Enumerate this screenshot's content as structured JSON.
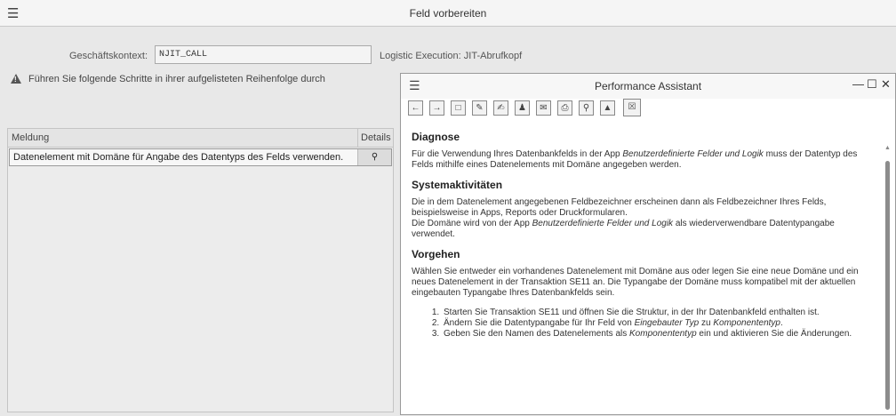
{
  "window": {
    "title": "Feld vorbereiten"
  },
  "context": {
    "label": "Geschäftskontext:",
    "value": "NJIT_CALL",
    "description": "Logistic Execution: JIT-Abrufkopf"
  },
  "warning": {
    "text": "Führen Sie folgende Schritte in ihrer aufgelisteten Reihenfolge durch"
  },
  "messages": {
    "headers": {
      "message": "Meldung",
      "details": "Details"
    },
    "rows": [
      {
        "text": "Datenelement mit Domäne für Angabe des Datentyps des Felds verwenden.",
        "details_icon": "magnifier-icon"
      }
    ]
  },
  "assistant": {
    "title": "Performance Assistant",
    "toolbar": [
      "back-icon",
      "forward-icon",
      "document-icon",
      "tools-icon",
      "edit-icon",
      "user-icon",
      "message-icon",
      "print-icon",
      "search-icon",
      "person-icon",
      "close-box-icon"
    ],
    "sections": {
      "diagnose_title": "Diagnose",
      "diagnose_p1a": "Für die Verwendung Ihres Datenbankfelds in der App ",
      "diagnose_p1i": "Benutzerdefinierte Felder und Logik",
      "diagnose_p1b": " muss der Datentyp des Felds mithilfe eines Datenelements mit Domäne angegeben werden.",
      "system_title": "Systemaktivitäten",
      "system_p1": "Die in dem Datenelement angegebenen Feldbezeichner erscheinen dann als Feldbezeichner Ihres Felds, beispielsweise in Apps, Reports oder Druckformularen.",
      "system_p2a": "Die Domäne wird von der App ",
      "system_p2i": "Benutzerdefinierte Felder und Logik",
      "system_p2b": " als wiederverwendbare Datentypangabe verwendet.",
      "vorgehen_title": "Vorgehen",
      "vorgehen_p1": "Wählen Sie entweder ein vorhandenes Datenelement mit Domäne aus oder legen Sie eine neue Domäne und ein neues Datenelement in der Transaktion SE11 an. Die Typangabe der Domäne muss kompatibel mit der aktuellen eingebauten Typangabe Ihres Datenbankfelds sein.",
      "step1": "Starten Sie Transaktion SE11 und öffnen Sie die Struktur, in der Ihr Datenbankfeld enthalten ist.",
      "step2a": "Ändern Sie die Datentypangabe für Ihr Feld von ",
      "step2i1": "Eingebauter Typ",
      "step2b": " zu ",
      "step2i2": "Komponententyp",
      "step2c": ".",
      "step3a": "Geben Sie den Namen des Datenelements als ",
      "step3i": "Komponententyp",
      "step3b": " ein und aktivieren Sie die Änderungen."
    }
  }
}
